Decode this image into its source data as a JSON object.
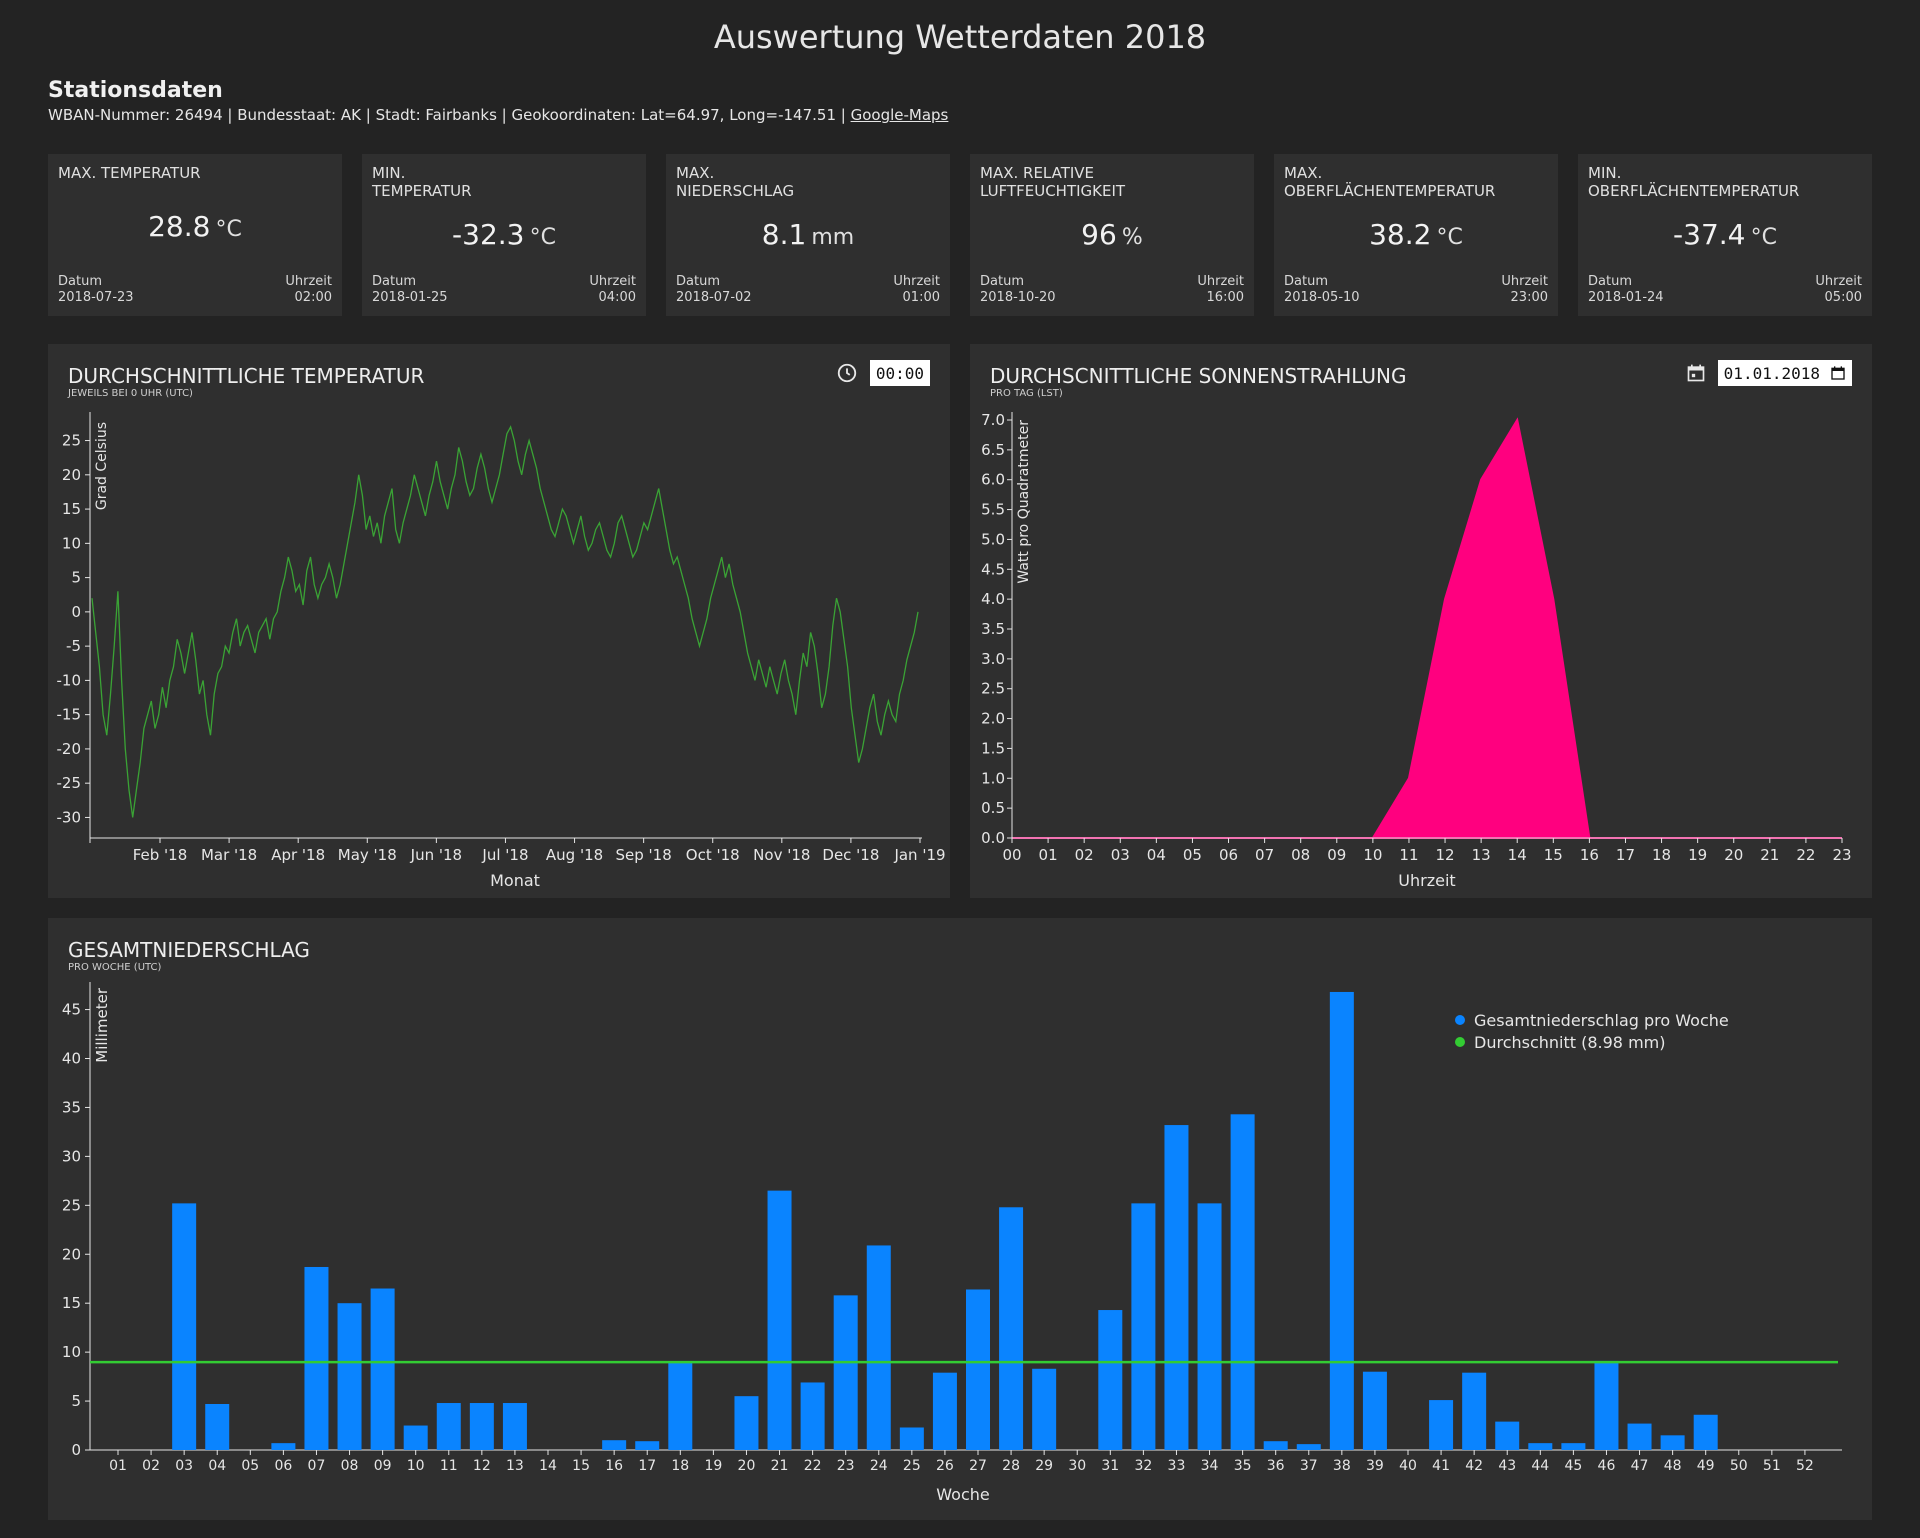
{
  "page": {
    "title": "Auswertung Wetterdaten 2018"
  },
  "station": {
    "heading": "Stationsdaten",
    "info": "WBAN-Nummer: 26494 | Bundesstaat: AK | Stadt: Fairbanks | Geokoordinaten:  Lat=64.97, Long=-147.51 |",
    "maps_link": "Google-Maps"
  },
  "kpis": [
    {
      "label": "MAX. TEMPERATUR",
      "value": "28.8",
      "unit": "°C",
      "date_label": "Datum",
      "date": "2018-07-23",
      "time_label": "Uhrzeit",
      "time": "02:00"
    },
    {
      "label": "MIN.\nTEMPERATUR",
      "value": "-32.3",
      "unit": "°C",
      "date_label": "Datum",
      "date": "2018-01-25",
      "time_label": "Uhrzeit",
      "time": "04:00"
    },
    {
      "label": "MAX.\nNIEDERSCHLAG",
      "value": "8.1",
      "unit": "mm",
      "date_label": "Datum",
      "date": "2018-07-02",
      "time_label": "Uhrzeit",
      "time": "01:00"
    },
    {
      "label": "MAX. RELATIVE\nLUFTFEUCHTIGKEIT",
      "value": "96",
      "unit": "%",
      "date_label": "Datum",
      "date": "2018-10-20",
      "time_label": "Uhrzeit",
      "time": "16:00"
    },
    {
      "label": "MAX.\nOBERFLÄCHENTEMPERATUR",
      "value": "38.2",
      "unit": "°C",
      "date_label": "Datum",
      "date": "2018-05-10",
      "time_label": "Uhrzeit",
      "time": "23:00"
    },
    {
      "label": "MIN.\nOBERFLÄCHENTEMPERATUR",
      "value": "-37.4",
      "unit": "°C",
      "date_label": "Datum",
      "date": "2018-01-24",
      "time_label": "Uhrzeit",
      "time": "05:00"
    }
  ],
  "temp_panel": {
    "title": "DURCHSCHNITTLICHE TEMPERATUR",
    "subtitle": "JEWEILS BEI 0 UHR (UTC)",
    "time_value": "00:00",
    "icon": "clock-icon"
  },
  "sun_panel": {
    "title": "DURCHSCNITTLICHE SONNENSTRAHLUNG",
    "subtitle": "PRO TAG (LST)",
    "date_value": "01.01.2018",
    "icon": "calendar-icon"
  },
  "precip_panel": {
    "title": "GESAMTNIEDERSCHLAG",
    "subtitle": "PRO WOCHE (UTC)"
  },
  "colors": {
    "temp_line": "#3aa335",
    "sun_area": "#ff007f",
    "bars": "#0a84ff",
    "avg_line": "#33cc33"
  },
  "chart_data": [
    {
      "type": "line",
      "xlabel": "Monat",
      "ylabel": "Grad Celsius",
      "ylim": [
        -33,
        28
      ],
      "yticks": [
        -30,
        -25,
        -20,
        -15,
        -10,
        -5,
        0,
        5,
        10,
        15,
        20,
        25
      ],
      "x_tick_labels": [
        "Feb '18",
        "Mar '18",
        "Apr '18",
        "May '18",
        "Jun '18",
        "Jul '18",
        "Aug '18",
        "Sep '18",
        "Oct '18",
        "Nov '18",
        "Dec '18",
        "Jan '19"
      ],
      "series": [
        {
          "values": [
            2,
            -3,
            -8,
            -15,
            -18,
            -12,
            -5,
            3,
            -10,
            -20,
            -26,
            -30,
            -26,
            -22,
            -17,
            -15,
            -13,
            -17,
            -15,
            -11,
            -14,
            -10,
            -8,
            -4,
            -6,
            -9,
            -6,
            -3,
            -7,
            -12,
            -10,
            -15,
            -18,
            -12,
            -9,
            -8,
            -5,
            -6,
            -3,
            -1,
            -5,
            -3,
            -2,
            -4,
            -6,
            -3,
            -2,
            -1,
            -4,
            -1,
            0,
            3,
            5,
            8,
            6,
            3,
            4,
            1,
            6,
            8,
            4,
            2,
            4,
            5,
            7,
            5,
            2,
            4,
            7,
            10,
            13,
            16,
            20,
            17,
            12,
            14,
            11,
            13,
            10,
            14,
            16,
            18,
            12,
            10,
            13,
            15,
            17,
            20,
            18,
            16,
            14,
            17,
            19,
            22,
            19,
            17,
            15,
            18,
            20,
            24,
            22,
            19,
            17,
            18,
            21,
            23,
            21,
            18,
            16,
            18,
            20,
            23,
            26,
            27,
            25,
            22,
            20,
            23,
            25,
            23,
            21,
            18,
            16,
            14,
            12,
            11,
            13,
            15,
            14,
            12,
            10,
            12,
            14,
            11,
            9,
            10,
            12,
            13,
            11,
            9,
            8,
            10,
            13,
            14,
            12,
            10,
            8,
            9,
            11,
            13,
            12,
            14,
            16,
            18,
            15,
            12,
            9,
            7,
            8,
            6,
            4,
            2,
            -1,
            -3,
            -5,
            -3,
            -1,
            2,
            4,
            6,
            8,
            5,
            7,
            4,
            2,
            0,
            -3,
            -6,
            -8,
            -10,
            -7,
            -9,
            -11,
            -8,
            -10,
            -12,
            -9,
            -7,
            -10,
            -12,
            -15,
            -10,
            -6,
            -8,
            -3,
            -5,
            -9,
            -14,
            -12,
            -8,
            -2,
            2,
            0,
            -4,
            -8,
            -14,
            -18,
            -22,
            -20,
            -17,
            -14,
            -12,
            -16,
            -18,
            -15,
            -13,
            -15,
            -16,
            -12,
            -10,
            -7,
            -5,
            -3,
            0
          ]
        }
      ]
    },
    {
      "type": "area",
      "xlabel": "Uhrzeit",
      "ylabel": "Watt pro Quadratmeter",
      "ylim": [
        0,
        7
      ],
      "yticks": [
        "0.0",
        "0.5",
        "1.0",
        "1.5",
        "2.0",
        "2.5",
        "3.0",
        "3.5",
        "4.0",
        "4.5",
        "5.0",
        "5.5",
        "6.0",
        "6.5",
        "7.0"
      ],
      "x": [
        "00",
        "01",
        "02",
        "03",
        "04",
        "05",
        "06",
        "07",
        "08",
        "09",
        "10",
        "11",
        "12",
        "13",
        "14",
        "15",
        "16",
        "17",
        "18",
        "19",
        "20",
        "21",
        "22",
        "23"
      ],
      "values": [
        0,
        0,
        0,
        0,
        0,
        0,
        0,
        0,
        0,
        0,
        0,
        1.0,
        4.0,
        6.0,
        7.0,
        4.0,
        0,
        0,
        0,
        0,
        0,
        0,
        0,
        0
      ]
    },
    {
      "type": "bar",
      "xlabel": "Woche",
      "ylabel": "Millimeter",
      "ylim": [
        0,
        47
      ],
      "yticks": [
        0,
        5,
        10,
        15,
        20,
        25,
        30,
        35,
        40,
        45
      ],
      "categories": [
        "01",
        "02",
        "03",
        "04",
        "05",
        "06",
        "07",
        "08",
        "09",
        "10",
        "11",
        "12",
        "13",
        "14",
        "15",
        "16",
        "17",
        "18",
        "19",
        "20",
        "21",
        "22",
        "23",
        "24",
        "25",
        "26",
        "27",
        "28",
        "29",
        "30",
        "31",
        "32",
        "33",
        "34",
        "35",
        "36",
        "37",
        "38",
        "39",
        "40",
        "41",
        "42",
        "43",
        "44",
        "45",
        "46",
        "47",
        "48",
        "49",
        "50",
        "51",
        "52"
      ],
      "values": [
        0,
        0,
        25.2,
        4.7,
        0,
        0.7,
        18.7,
        15.0,
        16.5,
        2.5,
        4.8,
        4.8,
        4.8,
        0,
        0,
        1.0,
        0.9,
        9.0,
        0,
        5.5,
        26.5,
        6.9,
        15.8,
        20.9,
        2.3,
        7.9,
        16.4,
        24.8,
        8.3,
        0,
        14.3,
        25.2,
        33.2,
        25.2,
        34.3,
        0.9,
        0.6,
        46.8,
        8.0,
        0,
        5.1,
        7.9,
        2.9,
        0.7,
        0.7,
        9.1,
        2.7,
        1.5,
        3.6,
        0,
        0,
        0
      ],
      "average": 8.98,
      "legend": [
        "Gesamtniederschlag pro Woche",
        "Durchschnitt (8.98 mm)"
      ]
    }
  ]
}
